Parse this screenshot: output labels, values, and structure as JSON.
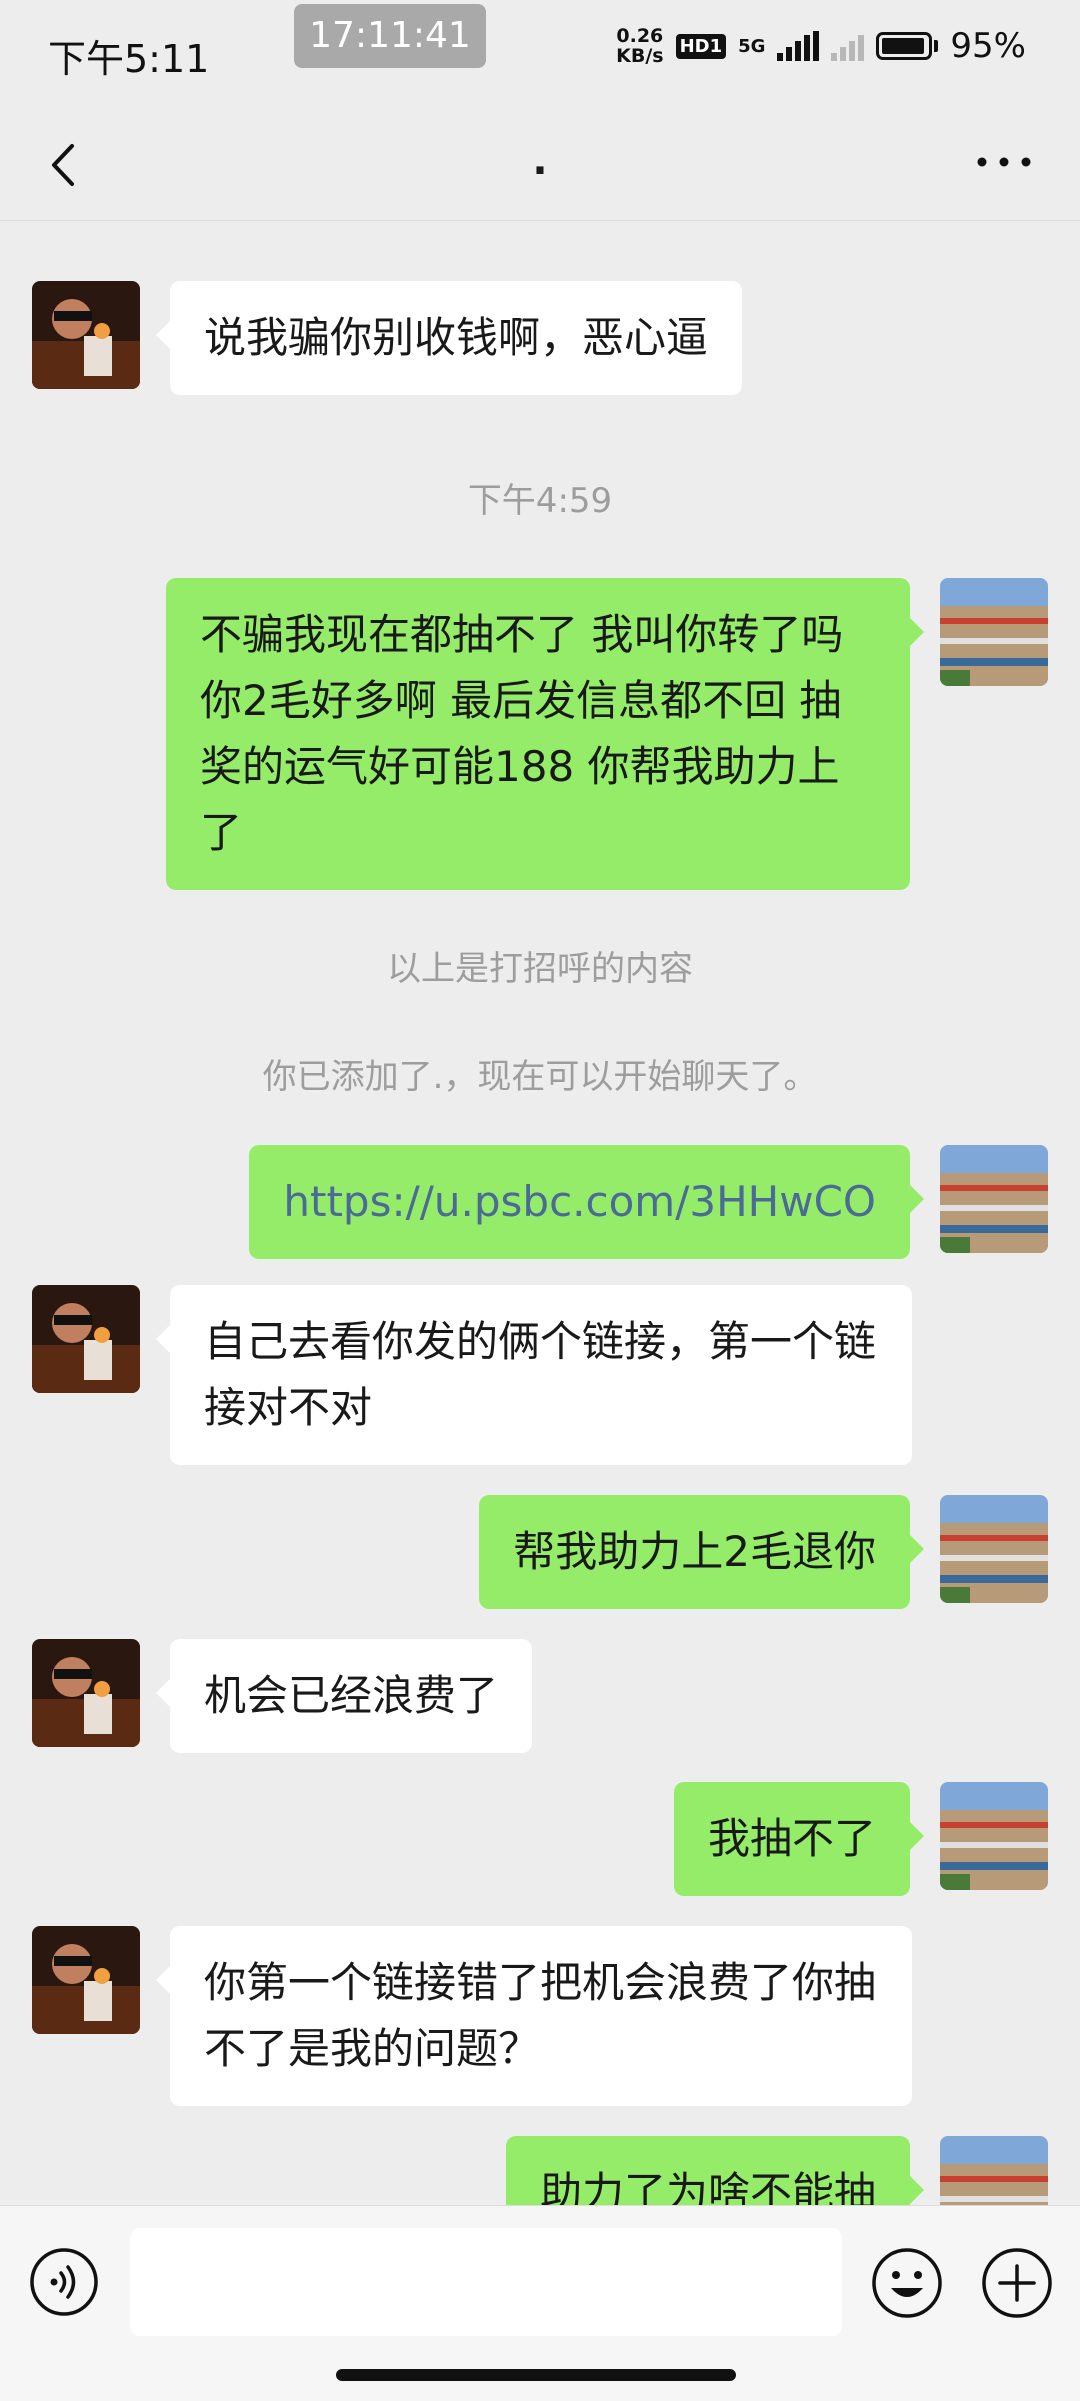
{
  "status_bar": {
    "time": "下午5:11",
    "clock_overlay": "17:11:41",
    "net_speed_value": "0.26",
    "net_speed_unit": "KB/s",
    "hd_badge": "HD1",
    "network_type": "5G",
    "battery_percent": "95%"
  },
  "nav": {
    "title": ".",
    "back_icon": "chevron-left-icon",
    "more_icon": "more-dots-icon"
  },
  "messages": [
    {
      "side": "in",
      "text": "说我骗你别收钱啊，恶心逼"
    },
    {
      "type": "timestamp",
      "text": "下午4:59"
    },
    {
      "side": "out",
      "text": "不骗我现在都抽不了  我叫你转了吗  你2毛好多啊  最后发信息都不回  抽奖的运气好可能188 你帮我助力上了"
    },
    {
      "type": "system",
      "text": "以上是打招呼的内容"
    },
    {
      "type": "system",
      "text": "你已添加了.，现在可以开始聊天了。"
    },
    {
      "side": "out",
      "text": "https://u.psbc.com/3HHwCO",
      "is_link": true
    },
    {
      "side": "in",
      "text": "自己去看你发的俩个链接，第一个链接对不对"
    },
    {
      "side": "out",
      "text": "帮我助力上2毛退你"
    },
    {
      "side": "in",
      "text": "机会已经浪费了"
    },
    {
      "side": "out",
      "text": "我抽不了"
    },
    {
      "side": "in",
      "text": "你第一个链接错了把机会浪费了你抽不了是我的问题？"
    },
    {
      "side": "out",
      "text": "助力了为啥不能抽"
    }
  ],
  "input_bar": {
    "voice_icon": "voice-icon",
    "input_value": "",
    "emoji_icon": "emoji-icon",
    "plus_icon": "plus-icon"
  },
  "colors": {
    "background": "#ededed",
    "bubble_out": "#95ec69",
    "bubble_in": "#ffffff",
    "system_text": "#9d9d9d",
    "link": "#4b6a96"
  }
}
